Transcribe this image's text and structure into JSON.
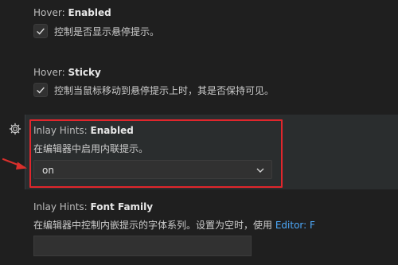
{
  "settings": [
    {
      "category": "Hover: ",
      "name": "Enabled",
      "description": "控制是否显示悬停提示。",
      "checked": true
    },
    {
      "category": "Hover: ",
      "name": "Sticky",
      "description": "控制当鼠标移动到悬停提示上时，其是否保持可见。",
      "checked": true
    },
    {
      "category": "Inlay Hints: ",
      "name": "Enabled",
      "description": "在编辑器中启用内联提示。",
      "select_value": "on"
    },
    {
      "category": "Inlay Hints: ",
      "name": "Font Family",
      "description": "在编辑器中控制内嵌提示的字体系列。设置为空时，使用 ",
      "link_text": "Editor: F",
      "input_value": ""
    }
  ],
  "colors": {
    "highlight": "#e0262c",
    "arrow": "#d9302c",
    "link": "#4daafc"
  },
  "icons": {
    "gear": "gear-icon",
    "check": "check-icon",
    "chevron": "chevron-down-icon"
  }
}
